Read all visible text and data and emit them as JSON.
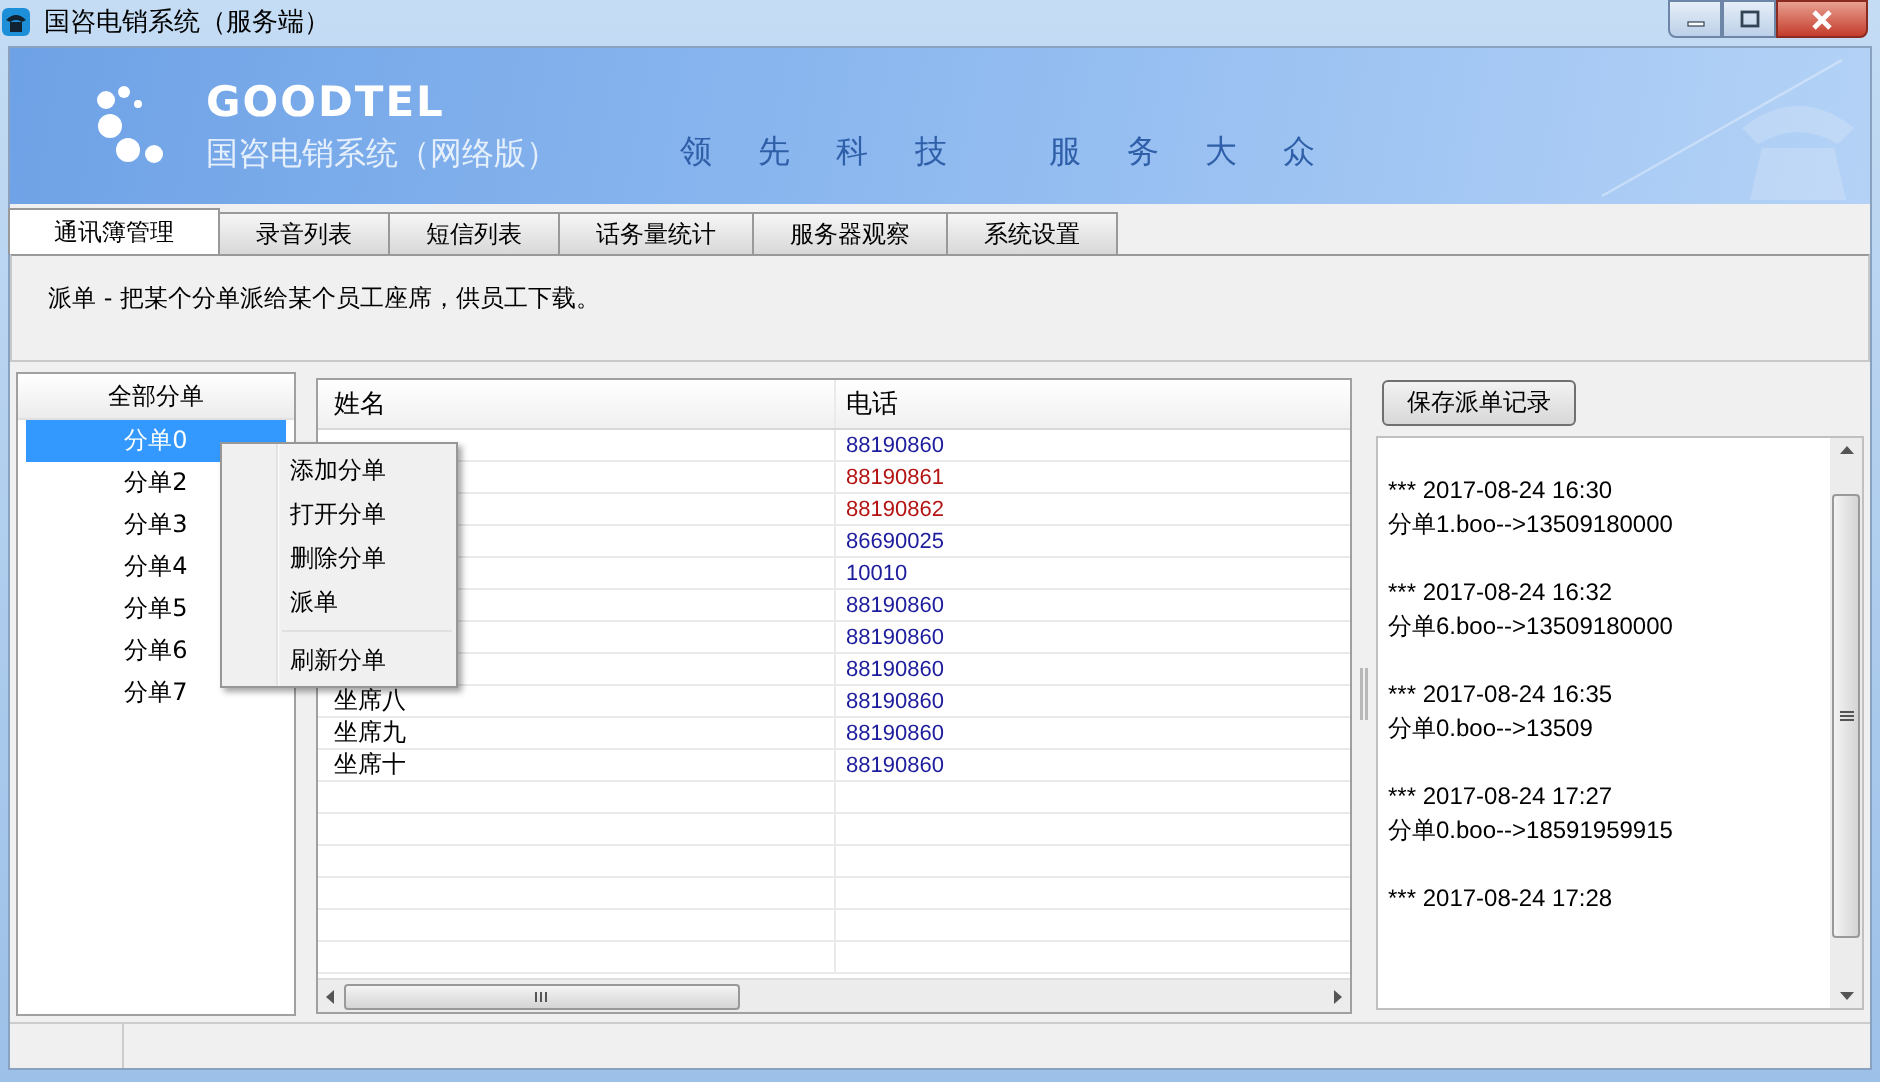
{
  "window": {
    "title": "国咨电销系统（服务端）"
  },
  "banner": {
    "logo": "GOODTEL",
    "subtitle": "国咨电销系统（网络版）",
    "slogan": [
      "领 先 科 技",
      "服 务 大 众"
    ]
  },
  "tabs": [
    {
      "label": "通讯簿管理",
      "selected": true
    },
    {
      "label": "录音列表",
      "selected": false
    },
    {
      "label": "短信列表",
      "selected": false
    },
    {
      "label": "话务量统计",
      "selected": false
    },
    {
      "label": "服务器观察",
      "selected": false
    },
    {
      "label": "系统设置",
      "selected": false
    }
  ],
  "description": "派单 - 把某个分单派给某个员工座席，供员工下载。",
  "branch_list": {
    "header": "全部分单",
    "items": [
      {
        "label": "分单0",
        "selected": true
      },
      {
        "label": "分单2",
        "selected": false
      },
      {
        "label": "分单3",
        "selected": false
      },
      {
        "label": "分单4",
        "selected": false
      },
      {
        "label": "分单5",
        "selected": false
      },
      {
        "label": "分单6",
        "selected": false
      },
      {
        "label": "分单7",
        "selected": false
      }
    ]
  },
  "table": {
    "columns": [
      "姓名",
      "电话"
    ],
    "rows": [
      {
        "phone": "88190860",
        "color": "#1c1c9c"
      },
      {
        "phone": "88190861",
        "color": "#b41414"
      },
      {
        "phone": "88190862",
        "color": "#b41414"
      },
      {
        "phone": "86690025",
        "color": "#1c1c9c"
      },
      {
        "phone": "10010",
        "color": "#1c1c9c"
      },
      {
        "phone": "88190860",
        "color": "#1c1c9c"
      },
      {
        "phone": "88190860",
        "color": "#1c1c9c"
      },
      {
        "phone": "88190860",
        "color": "#1c1c9c"
      },
      {
        "name": "坐席八",
        "phone": "88190860",
        "color": "#1c1c9c"
      },
      {
        "name": "坐席九",
        "phone": "88190860",
        "color": "#1c1c9c"
      },
      {
        "name": "坐席十",
        "phone": "88190860",
        "color": "#1c1c9c"
      }
    ]
  },
  "context_menu": {
    "items": [
      {
        "kind": "item",
        "label": "添加分单"
      },
      {
        "kind": "item",
        "label": "打开分单"
      },
      {
        "kind": "item",
        "label": "删除分单"
      },
      {
        "kind": "item",
        "label": "派单"
      },
      {
        "kind": "separator"
      },
      {
        "kind": "item",
        "label": "刷新分单"
      }
    ]
  },
  "save_button": "保存派单记录",
  "log": [
    {
      "stamp": "*** 2017-08-24 16:30",
      "detail": "分单1.boo-->13509180000"
    },
    {
      "stamp": "*** 2017-08-24 16:32",
      "detail": "分单6.boo-->13509180000"
    },
    {
      "stamp": "*** 2017-08-24 16:35",
      "detail": "分单0.boo-->13509"
    },
    {
      "stamp": "*** 2017-08-24 17:27",
      "detail": "分单0.boo-->18591959915"
    },
    {
      "stamp": "*** 2017-08-24 17:28"
    }
  ]
}
